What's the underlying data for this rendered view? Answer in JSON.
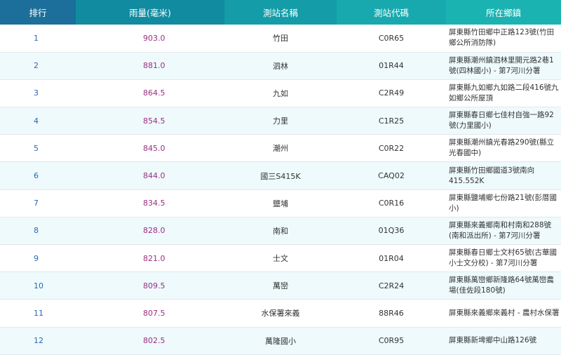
{
  "headers": {
    "rank": "排行",
    "rainfall": "雨量(毫米)",
    "station_name": "測站名稱",
    "station_code": "測站代碼",
    "township": "所在鄉鎮"
  },
  "rows": [
    {
      "rank": "1",
      "rainfall": "903.0",
      "name": "竹田",
      "code": "C0R65",
      "town": "屏東縣竹田鄉中正路123號(竹田鄉公所消防隊)"
    },
    {
      "rank": "2",
      "rainfall": "881.0",
      "name": "泗林",
      "code": "01R44",
      "town": "屏東縣潮州鎮泗林里開元路2巷1號(四林國小) - 第7河川分署"
    },
    {
      "rank": "3",
      "rainfall": "864.5",
      "name": "九如",
      "code": "C2R49",
      "town": "屏東縣九如鄉九如路二段416號九如鄉公所屋頂"
    },
    {
      "rank": "4",
      "rainfall": "854.5",
      "name": "力里",
      "code": "C1R25",
      "town": "屏東縣春日鄉七佳村自強一路92號(力里國小)"
    },
    {
      "rank": "5",
      "rainfall": "845.0",
      "name": "潮州",
      "code": "C0R22",
      "town": "屏東縣潮州鎮光春路290號(縣立光春國中)"
    },
    {
      "rank": "6",
      "rainfall": "844.0",
      "name": "國三S415K",
      "code": "CAQ02",
      "town": "屏東縣竹田鄉國道3號南向415.552K"
    },
    {
      "rank": "7",
      "rainfall": "834.5",
      "name": "鹽埔",
      "code": "C0R16",
      "town": "屏東縣鹽埔鄉七份路21號(彭厝國小)"
    },
    {
      "rank": "8",
      "rainfall": "828.0",
      "name": "南和",
      "code": "01Q36",
      "town": "屏東縣來義鄉南和村南和288號(南和派出所) - 第7河川分署"
    },
    {
      "rank": "9",
      "rainfall": "821.0",
      "name": "士文",
      "code": "01R04",
      "town": "屏東縣春日鄉士文村65號(古華國小士文分校) - 第7河川分署"
    },
    {
      "rank": "10",
      "rainfall": "809.5",
      "name": "萬巒",
      "code": "C2R24",
      "town": "屏東縣萬巒鄉新隆路64號萬巒農場(佳佐段180號)"
    },
    {
      "rank": "11",
      "rainfall": "807.5",
      "name": "水保署來義",
      "code": "88R46",
      "town": "屏東縣來義鄉來義村 - 農村水保署"
    },
    {
      "rank": "12",
      "rainfall": "802.5",
      "name": "萬隆國小",
      "code": "C0R95",
      "town": "屏東縣新埤鄉中山路126號"
    }
  ],
  "colors": {
    "rank_text": "#2a66b5",
    "rainfall_text": "#9b2f80",
    "header_dark": "#1b6f9a",
    "header_light": "#1ab3b2",
    "row_alt": "#eefafc"
  }
}
